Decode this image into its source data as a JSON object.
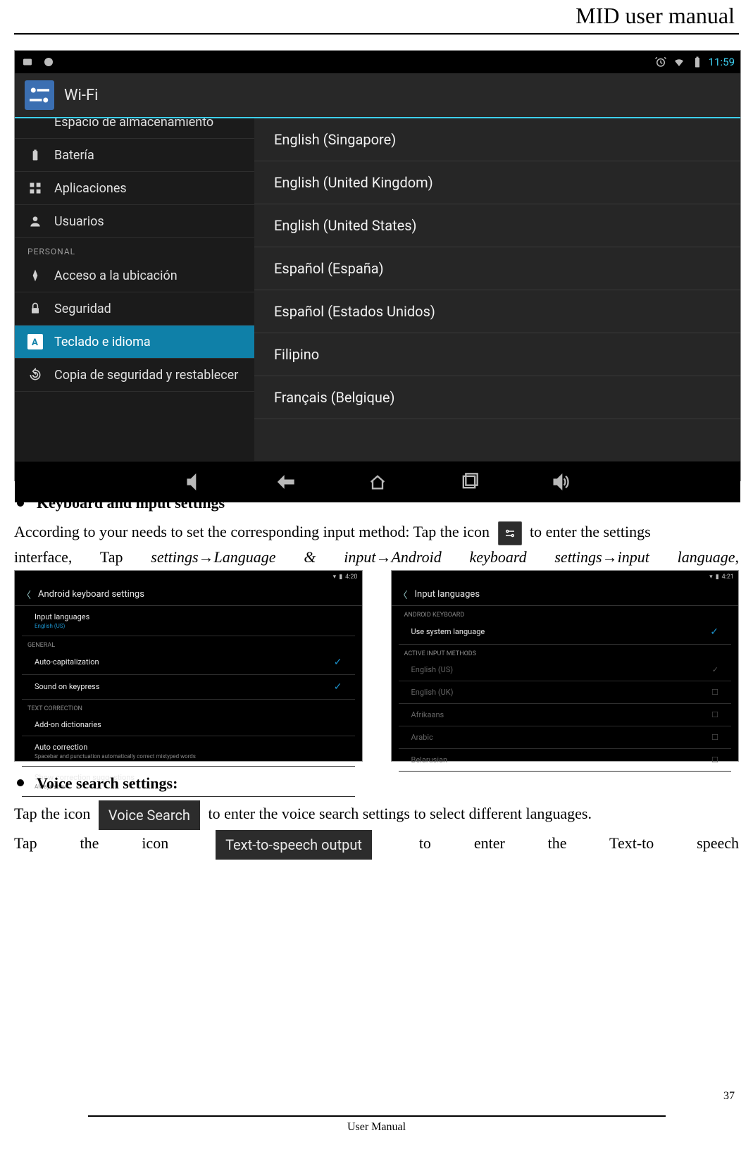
{
  "header": {
    "title": "MID user manual"
  },
  "footer": {
    "label": "User Manual",
    "page": "37"
  },
  "screenshot1": {
    "statusbar": {
      "time": "11:59"
    },
    "wifi_title": "Wi-Fi",
    "sidebar": {
      "truncated": "Espacio de almacenamiento",
      "items": [
        "Batería",
        "Aplicaciones",
        "Usuarios"
      ],
      "section": "PERSONAL",
      "items2": [
        "Acceso a la ubicación",
        "Seguridad",
        "Teclado e idioma",
        "Copia de seguridad y restablecer"
      ]
    },
    "languages": [
      "English (Singapore)",
      "English (United Kingdom)",
      "English (United States)",
      "Español (España)",
      "Español (Estados Unidos)",
      "Filipino",
      "Français (Belgique)"
    ]
  },
  "sections": {
    "kbd_heading": "Keyboard and input settings",
    "voice_heading": "Voice search settings:"
  },
  "text": {
    "kbd_p1a": "According to your needs to set the corresponding input method: Tap the icon ",
    "kbd_p1b": " to enter the settings",
    "kbd_p2": "interface,   Tap   ",
    "kbd_path": "settings→Language   &   input→Android   keyboard   settings→input   language",
    "kbd_p2_end": ",",
    "voice_p1a": "Tap the icon ",
    "voice_p1b": " to enter the voice search settings to select different languages.",
    "tts_a": "Tap      the      icon   ",
    "tts_b": "   to      enter      the      Text-to      speech"
  },
  "chips": {
    "voice": "Voice Search",
    "tts": "Text-to-speech output"
  },
  "screenshot2": {
    "time": "4:20",
    "title": "Android keyboard settings",
    "row_lang": {
      "label": "Input languages",
      "sub": "English (US)"
    },
    "section_general": "GENERAL",
    "rows_general": [
      "Auto-capitalization",
      "Sound on keypress"
    ],
    "section_text": "TEXT CORRECTION",
    "row_addon": "Add-on dictionaries",
    "row_auto": {
      "label": "Auto correction",
      "sub": "Spacebar and punctuation automatically correct mistyped words"
    },
    "row_sugg": {
      "label": "Show correction suggestions",
      "sub": "Always show"
    }
  },
  "screenshot3": {
    "time": "4:21",
    "title": "Input languages",
    "section_kbd": "ANDROID KEYBOARD",
    "row_system": "Use system language",
    "section_active": "ACTIVE INPUT METHODS",
    "langs": [
      "English (US)",
      "English (UK)",
      "Afrikaans",
      "Arabic",
      "Belarusian"
    ]
  }
}
